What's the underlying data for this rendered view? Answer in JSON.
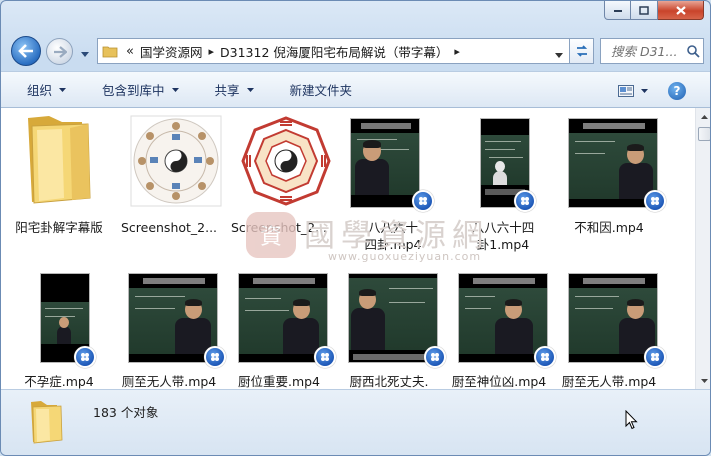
{
  "window": {
    "caption_buttons": [
      "minimize-icon",
      "maximize-icon",
      "close-icon"
    ]
  },
  "address": {
    "prefix": "«",
    "crumbs": [
      "国学资源网",
      "D31312 倪海厦阳宅布局解说（带字幕）"
    ],
    "separator": "▸"
  },
  "search": {
    "placeholder": "搜索 D31..."
  },
  "toolbar": {
    "organize": "组织",
    "include_library": "包含到库中",
    "share": "共享",
    "new_folder": "新建文件夹"
  },
  "items": [
    {
      "label": "阳宅卦解字幕版",
      "type": "folder"
    },
    {
      "label": "Screenshot_2...",
      "type": "image-bagua-1"
    },
    {
      "label": "Screenshot_2...",
      "type": "image-bagua-2"
    },
    {
      "label": "八八六十四卦.mp4",
      "type": "video"
    },
    {
      "label": "八八六十四卦1.mp4",
      "type": "video-narrow"
    },
    {
      "label": "不和因.mp4",
      "type": "video"
    },
    {
      "label": "不孕症.mp4",
      "type": "video-narrow"
    },
    {
      "label": "厕至无人带.mp4",
      "type": "video"
    },
    {
      "label": "厨位重要.mp4",
      "type": "video"
    },
    {
      "label": "厨西北死丈夫.",
      "type": "video"
    },
    {
      "label": "厨至神位凶.mp4",
      "type": "video"
    },
    {
      "label": "厨至无人带.mp4",
      "type": "video"
    }
  ],
  "status": {
    "count": "183 个对象"
  },
  "watermark": {
    "text": "國學資源網",
    "url": "www.guoxueziyuan.com"
  },
  "colors": {
    "accent": "#2b6fc2",
    "board": "#2e4a3b",
    "close": "#c9442b"
  }
}
